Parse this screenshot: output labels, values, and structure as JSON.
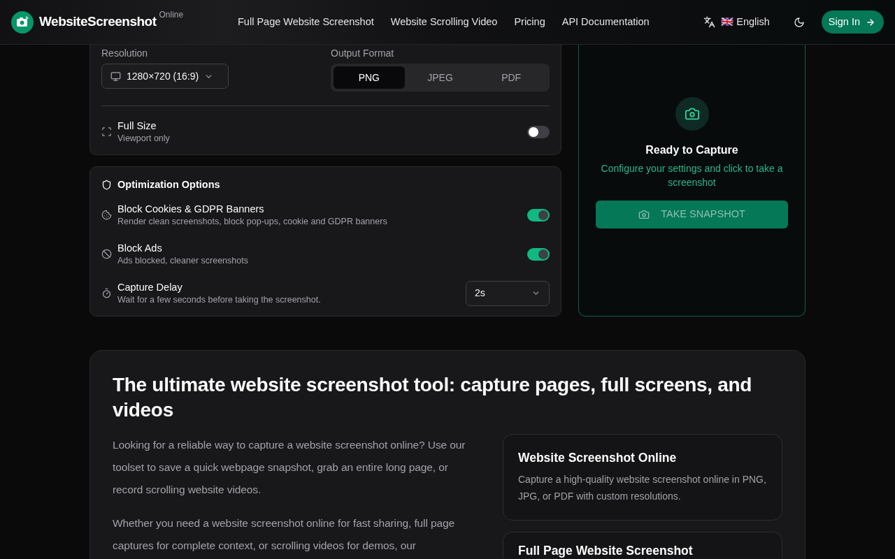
{
  "navbar": {
    "brand": "WebsiteScreenshot",
    "brand_tag": "Online",
    "links": [
      "Full Page Website Screenshot",
      "Website Scrolling Video",
      "Pricing",
      "API Documentation"
    ],
    "language": "🇬🇧 English",
    "sign_in": "Sign In"
  },
  "settings": {
    "resolution_label": "Resolution",
    "resolution": "1280×720 (16:9)",
    "format_label": "Output Format",
    "formats": [
      {
        "label": "PNG",
        "selected": true
      },
      {
        "label": "JPEG",
        "selected": false
      },
      {
        "label": "PDF",
        "selected": false
      }
    ],
    "full_size": {
      "title": "Full Size",
      "subtitle": "Viewport only",
      "on": false
    }
  },
  "optimization": {
    "title": "Optimization Options",
    "options": [
      {
        "kind": "toggle",
        "title": "Block Cookies & GDPR Banners",
        "subtitle": "Render clean screenshots, block pop-ups, cookie and GDPR banners",
        "on": true
      },
      {
        "kind": "toggle",
        "title": "Block Ads",
        "subtitle": "Ads blocked, cleaner screenshots",
        "on": true
      },
      {
        "kind": "select",
        "title": "Capture Delay",
        "subtitle": "Wait for a few seconds before taking the screenshot.",
        "value": "2s"
      }
    ]
  },
  "preview": {
    "title": "Ready to Capture",
    "text": "Configure your settings and click to take a screenshot",
    "button": "TAKE SNAPSHOT"
  },
  "intro": {
    "heading": "The ultimate website screenshot tool: capture pages, full screens, and videos",
    "paragraphs": [
      "Looking for a reliable way to capture a website screenshot online? Use our toolset to save a quick webpage snapshot, grab an entire long page, or record scrolling website videos.",
      "Whether you need a website screenshot online for fast sharing, full page captures for complete context, or scrolling videos for demos, our"
    ],
    "features": [
      {
        "title": "Website Screenshot Online",
        "text": "Capture a high-quality website screenshot online in PNG, JPG, or PDF with custom resolutions."
      },
      {
        "title": "Full Page Website Screenshot"
      }
    ]
  }
}
